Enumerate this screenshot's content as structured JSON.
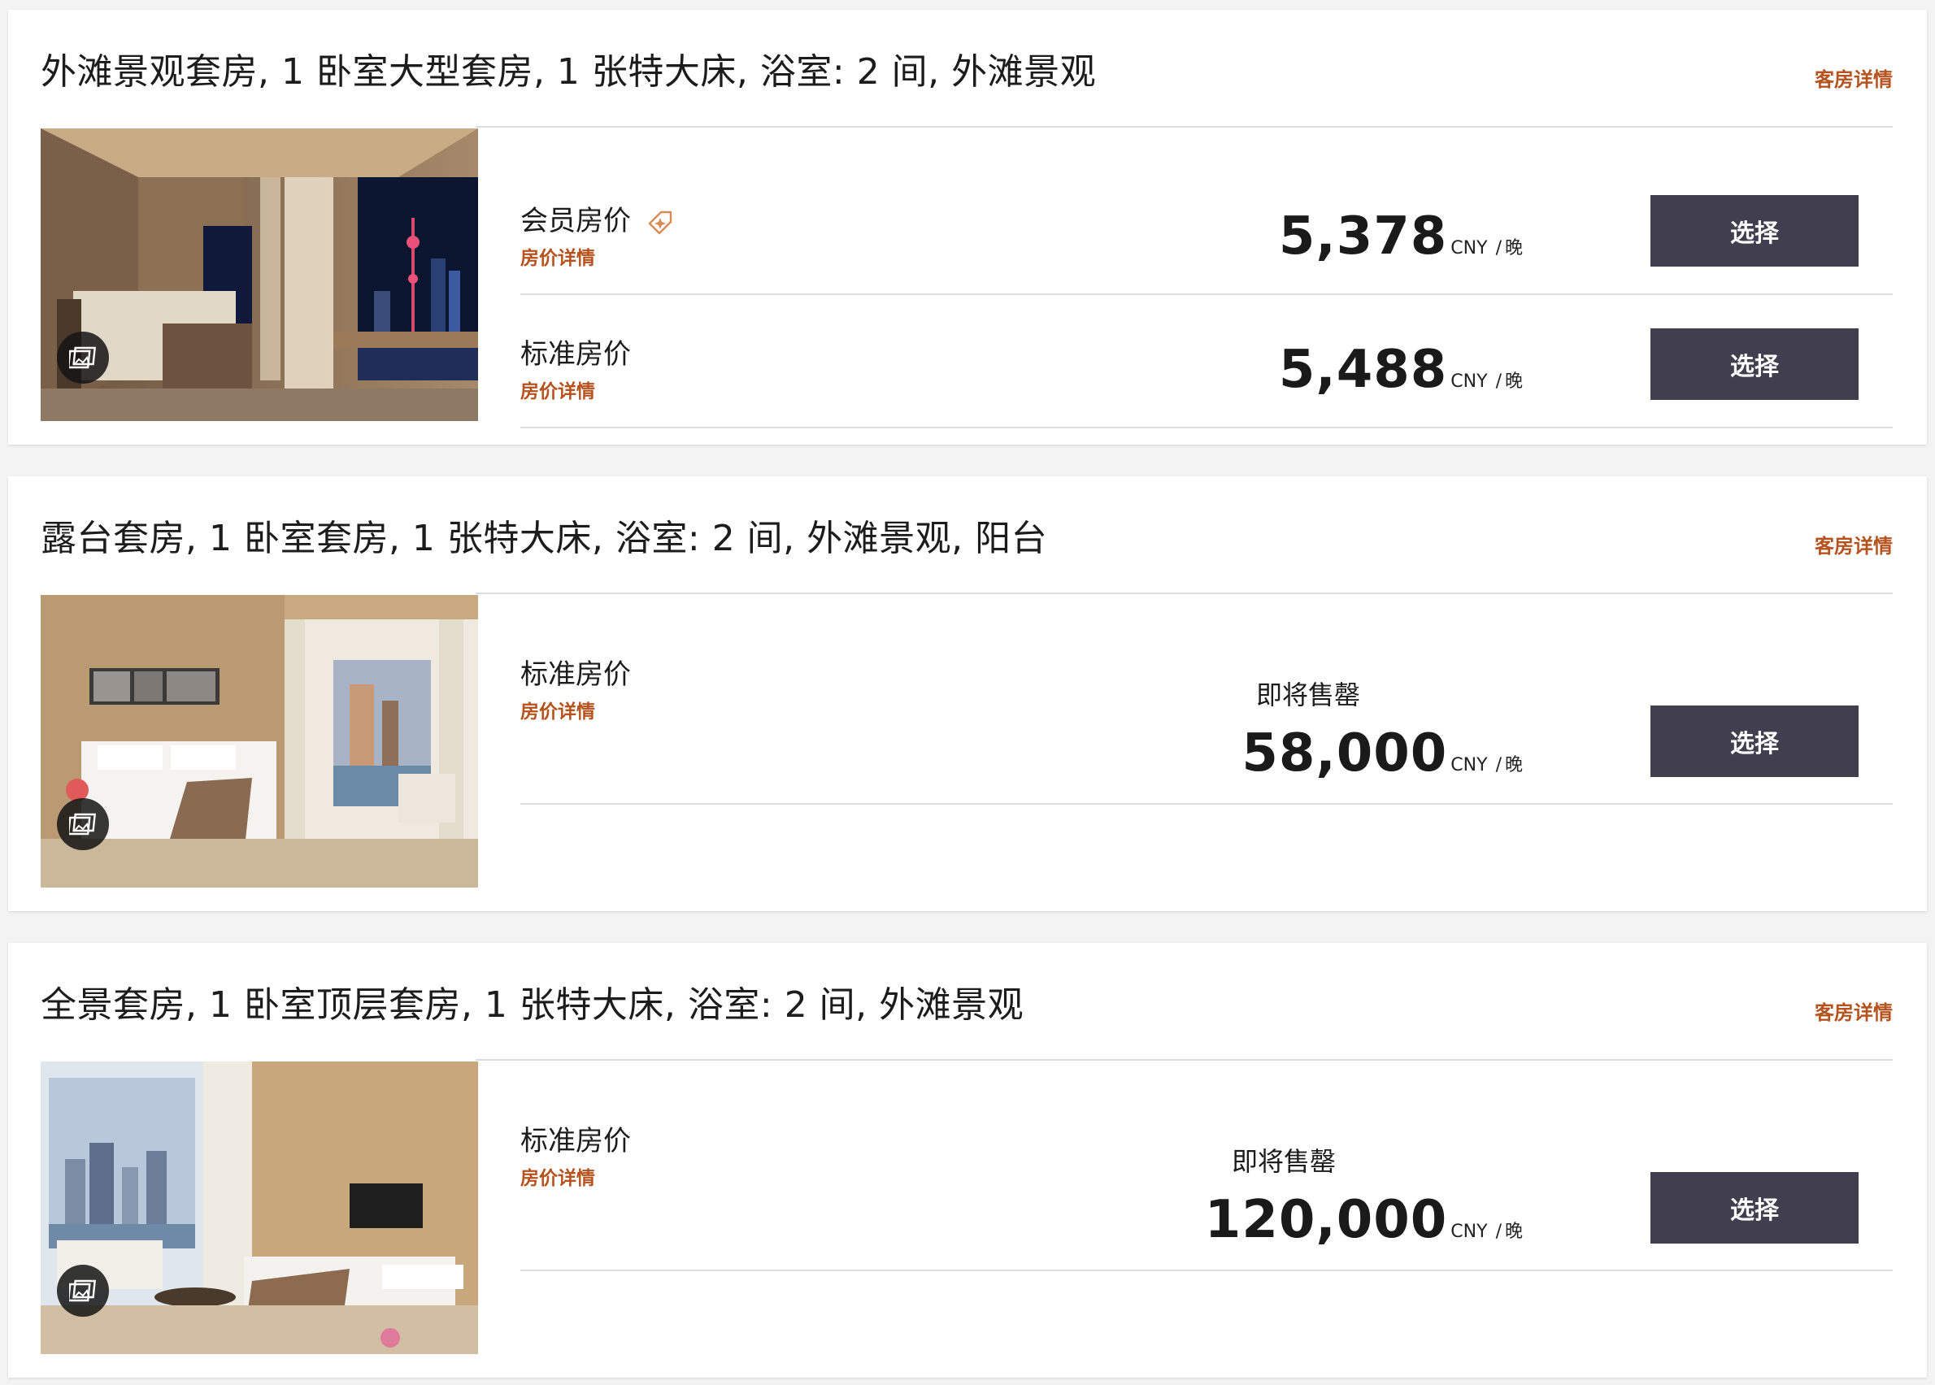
{
  "rooms": [
    {
      "title": "外滩景观套房, 1 卧室大型套房, 1 张特大床, 浴室: 2 间, 外滩景观",
      "details_link": "客房详情",
      "rates": [
        {
          "name": "会员房价",
          "details": "房价详情",
          "member_tag": true,
          "price": "5,378",
          "currency": "CNY",
          "sep": "/",
          "per": "晚",
          "button": "选择"
        },
        {
          "name": "标准房价",
          "details": "房价详情",
          "price": "5,488",
          "currency": "CNY",
          "sep": "/",
          "per": "晚",
          "button": "选择"
        }
      ]
    },
    {
      "title": "露台套房, 1 卧室套房, 1 张特大床, 浴室: 2 间, 外滩景观, 阳台",
      "details_link": "客房详情",
      "rates": [
        {
          "name": "标准房价",
          "details": "房价详情",
          "status": "即将售罄",
          "price": "58,000",
          "currency": "CNY",
          "sep": "/",
          "per": "晚",
          "button": "选择"
        }
      ]
    },
    {
      "title": "全景套房, 1 卧室顶层套房, 1 张特大床, 浴室: 2 间, 外滩景观",
      "details_link": "客房详情",
      "rates": [
        {
          "name": "标准房价",
          "details": "房价详情",
          "status": "即将售罄",
          "price": "120,000",
          "currency": "CNY",
          "sep": "/",
          "per": "晚",
          "button": "选择"
        }
      ]
    }
  ],
  "colors": {
    "accent": "#b5521d",
    "button": "#403e4f",
    "divider": "#dcdcdc"
  },
  "icons": [
    "gallery-icon",
    "member-tag-icon"
  ]
}
